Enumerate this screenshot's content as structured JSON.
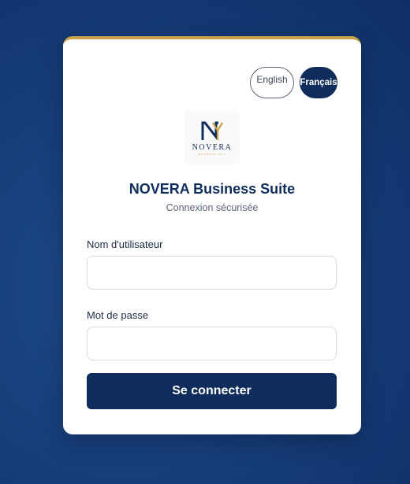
{
  "language_switch": {
    "english_label": "English",
    "french_label": "Français",
    "active": "Français"
  },
  "logo": {
    "wordmark": "NOVERA",
    "tagline": "BUSINESS SUIT"
  },
  "header": {
    "title": "NOVERA Business Suite",
    "subtitle": "Connexion sécurisée"
  },
  "form": {
    "username_label": "Nom d'utilisateur",
    "username_value": "",
    "password_label": "Mot de passe",
    "password_value": "",
    "submit_label": "Se connecter"
  },
  "colors": {
    "brand_navy": "#0f2d5c",
    "accent_gold": "#c9a24a",
    "background_blue": "#173f7c"
  }
}
